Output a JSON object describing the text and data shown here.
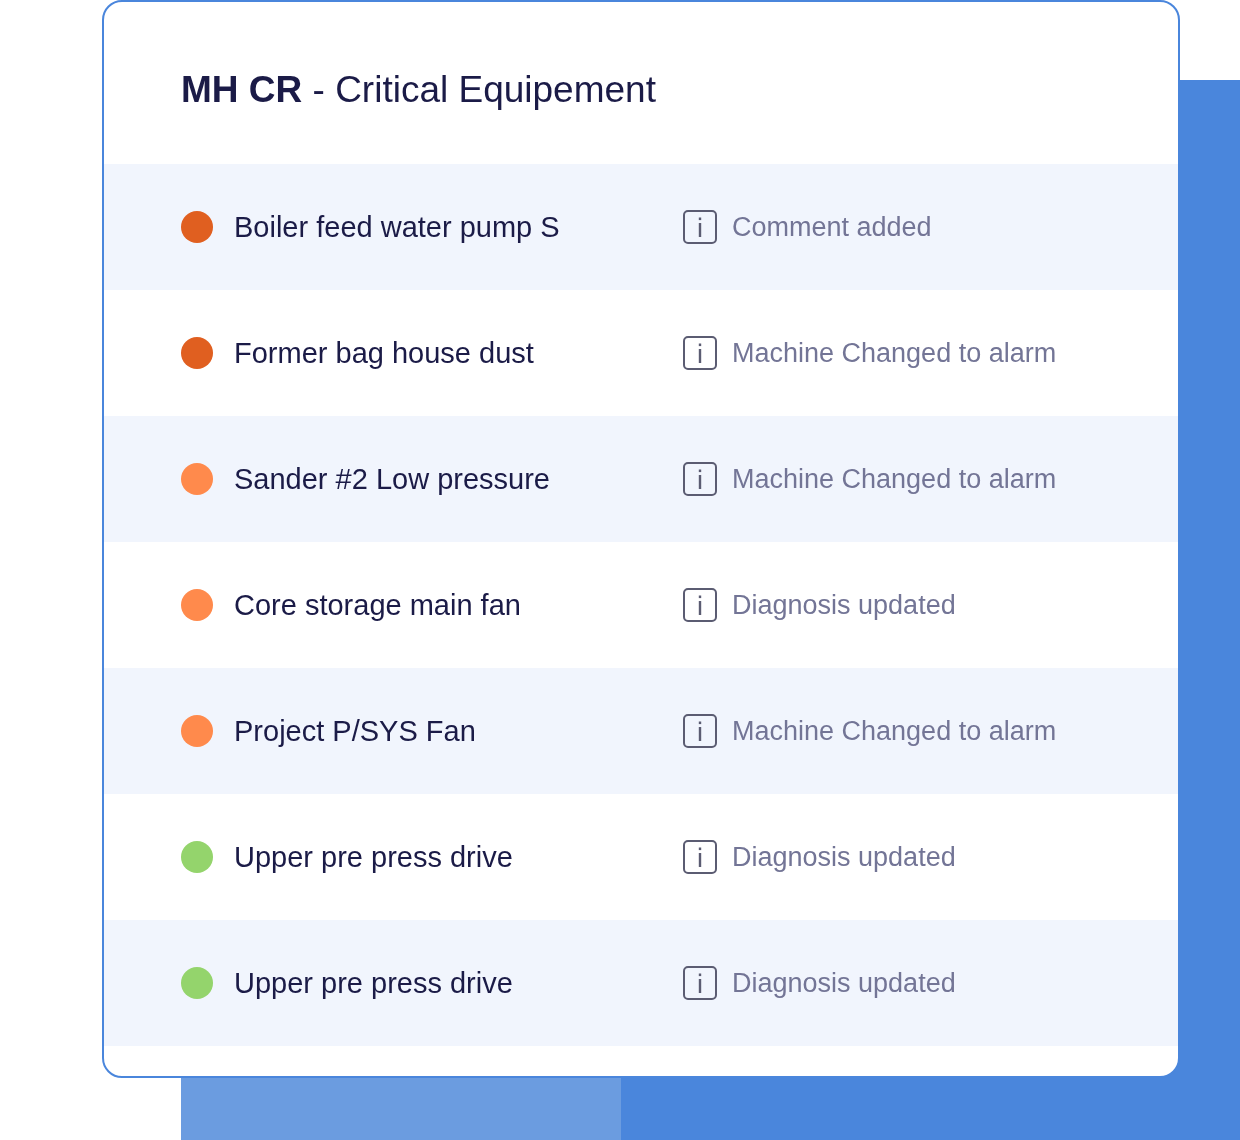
{
  "title": "**MH CR** - Critical Equipement",
  "rows": [
    {
      "name": "Boiler feed water pump S",
      "color": "#e05f20",
      "status": "Comment added"
    },
    {
      "name": "Former bag house dust",
      "color": "#e05f20",
      "status": "Machine Changed to alarm"
    },
    {
      "name": "Sander #2 Low pressure",
      "color": "#ff8a4c",
      "status": "Machine Changed to alarm"
    },
    {
      "name": "Core storage main fan",
      "color": "#ff8a4c",
      "status": "Diagnosis updated"
    },
    {
      "name": "Project P/SYS Fan",
      "color": "#ff8a4c",
      "status": "Machine Changed to alarm"
    },
    {
      "name": "Upper pre press drive",
      "color": "#94d46c",
      "status": "Diagnosis updated"
    },
    {
      "name": "Upper pre press drive",
      "color": "#94d46c",
      "status": "Diagnosis updated"
    }
  ]
}
